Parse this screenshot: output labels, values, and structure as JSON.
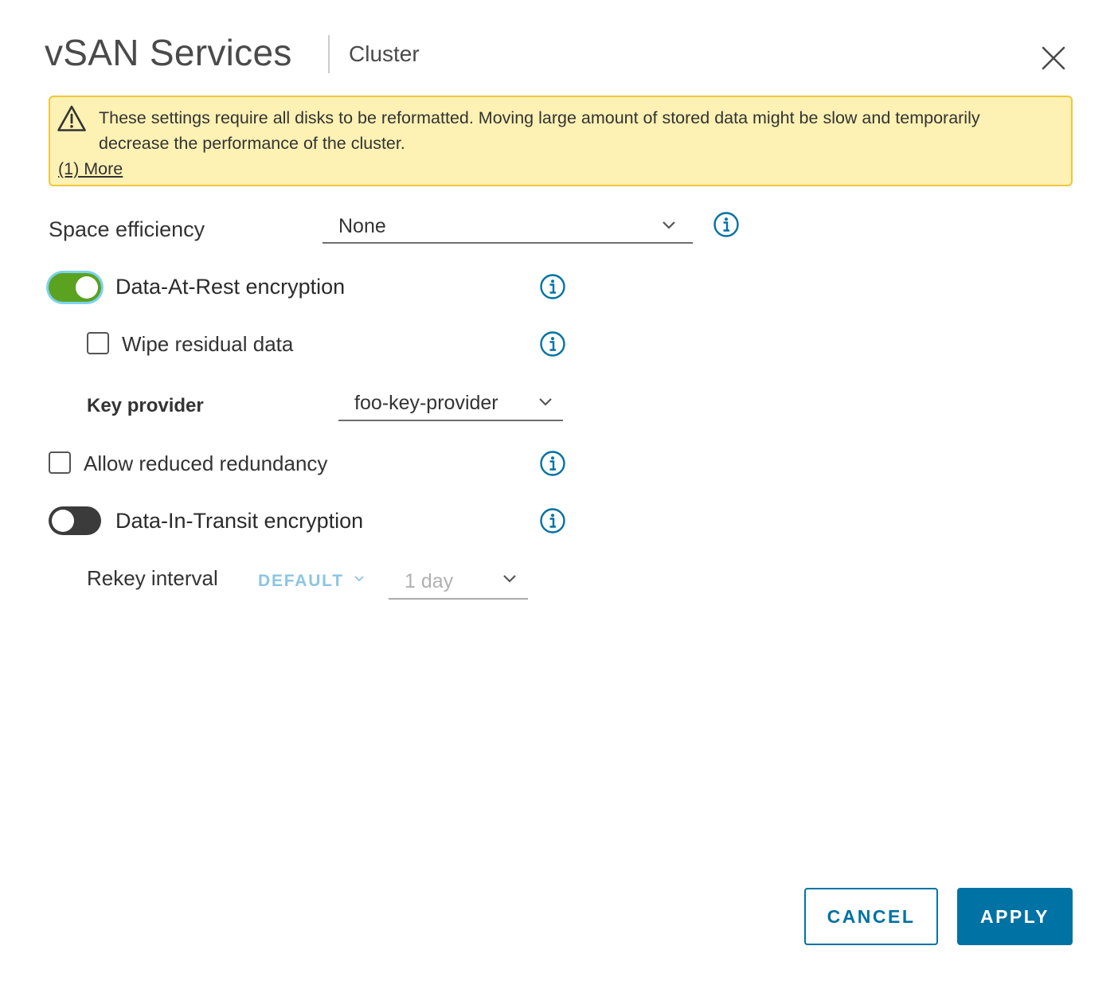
{
  "header": {
    "title": "vSAN Services",
    "subtitle": "Cluster",
    "close_icon": "close-icon"
  },
  "alert": {
    "type": "warning",
    "icon": "warning-triangle-icon",
    "message": "These settings require all disks to be reformatted. Moving large amount of stored data might be slow and temporarily decrease the performance of the cluster.",
    "more_link": "(1) More",
    "background_color": "#fdf1b3",
    "border_color": "#eec73f"
  },
  "form": {
    "space_efficiency": {
      "label": "Space efficiency",
      "selected": "None",
      "info_icon": "info-icon"
    },
    "data_at_rest": {
      "label": "Data-At-Rest encryption",
      "enabled": true,
      "info_icon": "info-icon",
      "toggle_on_color": "#5aa220"
    },
    "wipe_residual": {
      "label": "Wipe residual data",
      "checked": false,
      "info_icon": "info-icon"
    },
    "key_provider": {
      "label": "Key provider",
      "selected": "foo-key-provider"
    },
    "allow_reduced_redundancy": {
      "label": "Allow reduced redundancy",
      "checked": false,
      "info_icon": "info-icon"
    },
    "data_in_transit": {
      "label": "Data-In-Transit encryption",
      "enabled": false,
      "info_icon": "info-icon",
      "toggle_off_color": "#3b3b3b"
    },
    "rekey_interval": {
      "label": "Rekey interval",
      "mode": "DEFAULT",
      "selected": "1 day",
      "disabled": true
    }
  },
  "footer": {
    "cancel_label": "CANCEL",
    "apply_label": "APPLY",
    "primary_color": "#0072a3"
  },
  "colors": {
    "info_icon": "#0072a3",
    "link_disabled": "#8cc5e3"
  }
}
